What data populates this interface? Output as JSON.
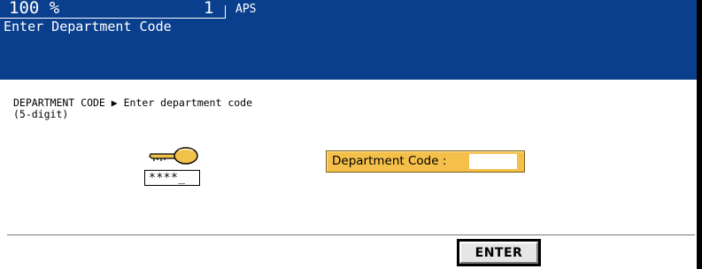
{
  "header": {
    "zoom": "100 %",
    "copies": "1",
    "paper_mode": "APS",
    "message": "Enter Department Code"
  },
  "prompt": {
    "line1": "DEPARTMENT CODE ▶ Enter department code",
    "line2": "(5-digit)"
  },
  "password_indicator": "****_",
  "department_code": {
    "label": "Department Code :",
    "value": ""
  },
  "enter_button": {
    "label": "ENTER"
  },
  "colors": {
    "header_bg": "#0a3f8e",
    "field_bg": "#f5c04a",
    "key_icon": "#f0c24a"
  },
  "icons": {
    "key": "key-icon"
  }
}
